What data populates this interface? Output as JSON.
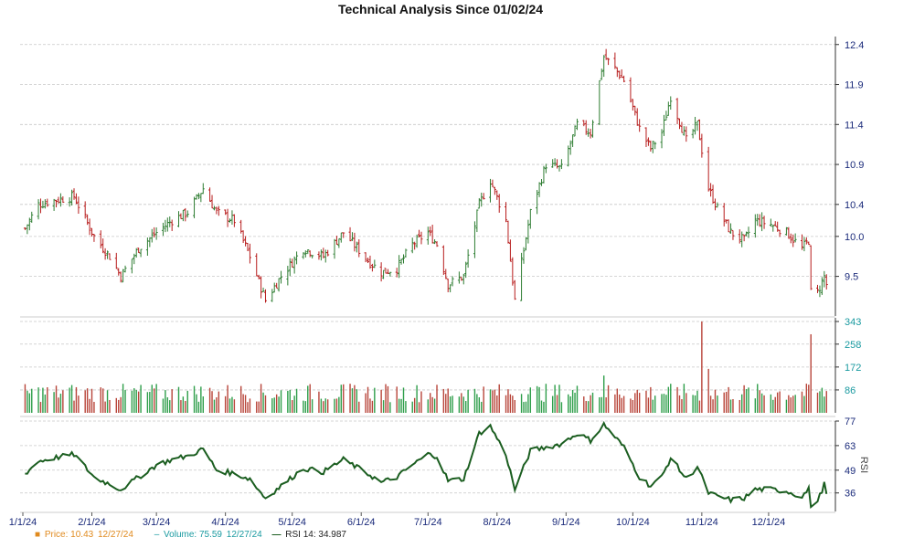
{
  "chart_data": {
    "type": "candlestick",
    "title": "Technical Analysis Since 01/02/24",
    "x_ticks": [
      "1/1/24",
      "2/1/24",
      "3/1/24",
      "4/1/24",
      "5/1/24",
      "6/1/24",
      "7/1/24",
      "8/1/24",
      "9/1/24",
      "10/1/24",
      "11/1/24",
      "12/1/24"
    ],
    "panels": {
      "price": {
        "ylim": [
          9.05,
          12.5
        ],
        "ticks": [
          12.4,
          11.9,
          11.4,
          10.9,
          10.4,
          10.0,
          9.5
        ],
        "tick_labels": [
          "12.4",
          "11.9",
          "11.4",
          "10.9",
          "10.4",
          "10.0",
          "9.5"
        ],
        "up_color": "#2e7d32",
        "down_color": "#b71c1c",
        "close_anchors": [
          [
            "2024-01-02",
            10.1
          ],
          [
            "2024-01-08",
            10.4
          ],
          [
            "2024-01-15",
            10.45
          ],
          [
            "2024-01-24",
            10.5
          ],
          [
            "2024-02-02",
            10.0
          ],
          [
            "2024-02-09",
            9.75
          ],
          [
            "2024-02-14",
            9.5
          ],
          [
            "2024-02-22",
            9.85
          ],
          [
            "2024-03-01",
            10.05
          ],
          [
            "2024-03-08",
            10.2
          ],
          [
            "2024-03-15",
            10.3
          ],
          [
            "2024-03-22",
            10.6
          ],
          [
            "2024-03-28",
            10.3
          ],
          [
            "2024-04-05",
            10.2
          ],
          [
            "2024-04-12",
            9.75
          ],
          [
            "2024-04-19",
            9.2
          ],
          [
            "2024-04-26",
            9.5
          ],
          [
            "2024-05-06",
            9.85
          ],
          [
            "2024-05-15",
            9.75
          ],
          [
            "2024-05-24",
            10.05
          ],
          [
            "2024-06-04",
            9.7
          ],
          [
            "2024-06-10",
            9.55
          ],
          [
            "2024-06-17",
            9.6
          ],
          [
            "2024-06-24",
            9.9
          ],
          [
            "2024-07-01",
            10.05
          ],
          [
            "2024-07-05",
            9.9
          ],
          [
            "2024-07-10",
            9.4
          ],
          [
            "2024-07-17",
            9.5
          ],
          [
            "2024-07-24",
            10.4
          ],
          [
            "2024-07-29",
            10.7
          ],
          [
            "2024-08-05",
            10.2
          ],
          [
            "2024-08-09",
            9.2
          ],
          [
            "2024-08-16",
            10.3
          ],
          [
            "2024-08-23",
            10.9
          ],
          [
            "2024-08-30",
            10.85
          ],
          [
            "2024-09-06",
            11.4
          ],
          [
            "2024-09-12",
            11.3
          ],
          [
            "2024-09-18",
            12.25
          ],
          [
            "2024-09-23",
            12.1
          ],
          [
            "2024-09-27",
            11.95
          ],
          [
            "2024-10-04",
            11.35
          ],
          [
            "2024-10-09",
            11.1
          ],
          [
            "2024-10-14",
            11.3
          ],
          [
            "2024-10-18",
            11.75
          ],
          [
            "2024-10-25",
            11.2
          ],
          [
            "2024-10-30",
            11.4
          ],
          [
            "2024-11-04",
            10.6
          ],
          [
            "2024-11-08",
            10.35
          ],
          [
            "2024-11-14",
            10.05
          ],
          [
            "2024-11-20",
            9.95
          ],
          [
            "2024-11-25",
            10.2
          ],
          [
            "2024-12-02",
            10.15
          ],
          [
            "2024-12-09",
            10.05
          ],
          [
            "2024-12-16",
            9.85
          ],
          [
            "2024-12-19",
            9.95
          ],
          [
            "2024-12-20",
            9.3
          ],
          [
            "2024-12-23",
            9.3
          ],
          [
            "2024-12-26",
            9.5
          ],
          [
            "2024-12-27",
            9.4
          ]
        ]
      },
      "volume": {
        "ylim": [
          0,
          343
        ],
        "ticks": [
          343,
          258,
          172,
          86
        ],
        "tick_labels": [
          "343",
          "258",
          "172",
          "86"
        ],
        "label_color": "#1a9aa0",
        "spikes": [
          [
            "2024-09-18",
            140
          ],
          [
            "2024-11-01",
            343
          ],
          [
            "2024-11-04",
            165
          ],
          [
            "2024-12-20",
            295
          ]
        ]
      },
      "rsi": {
        "ylim": [
          27,
          77
        ],
        "ticks": [
          77,
          63,
          49,
          36
        ],
        "tick_labels": [
          "77",
          "63",
          "49",
          "36"
        ],
        "axis_label": "RSI",
        "line_color": "#1b5e20",
        "anchors": [
          [
            "2024-01-02",
            47
          ],
          [
            "2024-01-08",
            54
          ],
          [
            "2024-01-15",
            56
          ],
          [
            "2024-01-24",
            58
          ],
          [
            "2024-02-02",
            45
          ],
          [
            "2024-02-09",
            41
          ],
          [
            "2024-02-14",
            38
          ],
          [
            "2024-02-22",
            45
          ],
          [
            "2024-03-01",
            52
          ],
          [
            "2024-03-08",
            55
          ],
          [
            "2024-03-15",
            57
          ],
          [
            "2024-03-22",
            61
          ],
          [
            "2024-03-28",
            49
          ],
          [
            "2024-04-05",
            47
          ],
          [
            "2024-04-12",
            44
          ],
          [
            "2024-04-19",
            33
          ],
          [
            "2024-04-26",
            40
          ],
          [
            "2024-05-06",
            50
          ],
          [
            "2024-05-15",
            48
          ],
          [
            "2024-05-24",
            55
          ],
          [
            "2024-06-04",
            47
          ],
          [
            "2024-06-10",
            42
          ],
          [
            "2024-06-17",
            45
          ],
          [
            "2024-06-24",
            52
          ],
          [
            "2024-07-01",
            58
          ],
          [
            "2024-07-05",
            57
          ],
          [
            "2024-07-10",
            43
          ],
          [
            "2024-07-17",
            44
          ],
          [
            "2024-07-24",
            70
          ],
          [
            "2024-07-29",
            74
          ],
          [
            "2024-08-05",
            58
          ],
          [
            "2024-08-09",
            38
          ],
          [
            "2024-08-16",
            60
          ],
          [
            "2024-08-23",
            62
          ],
          [
            "2024-08-30",
            64
          ],
          [
            "2024-09-06",
            70
          ],
          [
            "2024-09-12",
            66
          ],
          [
            "2024-09-18",
            75
          ],
          [
            "2024-09-23",
            68
          ],
          [
            "2024-09-27",
            62
          ],
          [
            "2024-10-04",
            45
          ],
          [
            "2024-10-09",
            40
          ],
          [
            "2024-10-14",
            45
          ],
          [
            "2024-10-18",
            56
          ],
          [
            "2024-10-25",
            44
          ],
          [
            "2024-10-30",
            51
          ],
          [
            "2024-11-04",
            36
          ],
          [
            "2024-11-08",
            34
          ],
          [
            "2024-11-14",
            32
          ],
          [
            "2024-11-20",
            33
          ],
          [
            "2024-11-25",
            38
          ],
          [
            "2024-12-02",
            38
          ],
          [
            "2024-12-09",
            37
          ],
          [
            "2024-12-16",
            34
          ],
          [
            "2024-12-19",
            38
          ],
          [
            "2024-12-20",
            29
          ],
          [
            "2024-12-23",
            31
          ],
          [
            "2024-12-26",
            41
          ],
          [
            "2024-12-27",
            35
          ]
        ]
      }
    },
    "legend": [
      {
        "label": "Price: 10.43",
        "date": "12/27/24",
        "color": "#e08a1e",
        "marker": "square"
      },
      {
        "label": "Volume: 75.59",
        "date": "12/27/24",
        "color": "#1a9aa0",
        "marker": "dash"
      },
      {
        "label": "RSI 14: 34.987",
        "date": "",
        "color": "#1b5e20",
        "marker": "line"
      }
    ],
    "grid": true
  }
}
